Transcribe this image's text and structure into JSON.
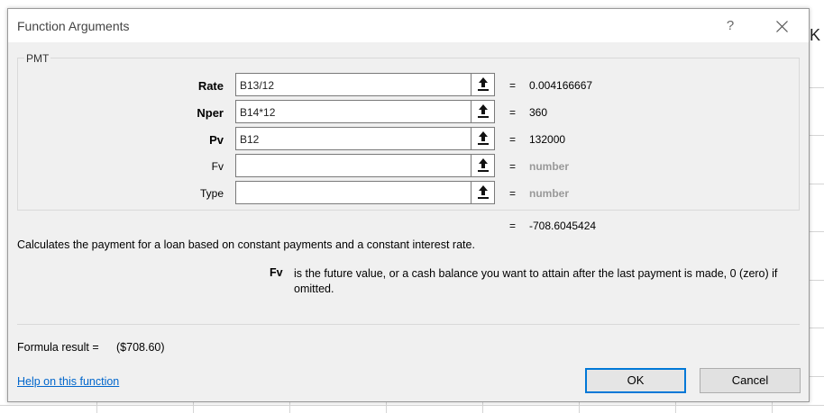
{
  "window": {
    "title": "Function Arguments",
    "help_glyph": "?",
    "background_column_header": "K"
  },
  "function": {
    "name": "PMT",
    "description": "Calculates the payment for a loan based on constant payments and a constant interest rate."
  },
  "arguments": [
    {
      "label": "Rate",
      "value": "B13/12",
      "evaluated": "0.004166667",
      "required": true
    },
    {
      "label": "Nper",
      "value": "B14*12",
      "evaluated": "360",
      "required": true
    },
    {
      "label": "Pv",
      "value": "B12",
      "evaluated": "132000",
      "required": true
    },
    {
      "label": "Fv",
      "value": "",
      "evaluated": "number",
      "required": false
    },
    {
      "label": "Type",
      "value": "",
      "evaluated": "number",
      "required": false
    }
  ],
  "equals_sign": "=",
  "result_value": "-708.6045424",
  "argument_help": {
    "name": "Fv",
    "text": "is the future value, or a cash balance you want to attain after the last payment is made, 0 (zero) if omitted."
  },
  "formula_result": {
    "label": "Formula result =",
    "value": "($708.60)"
  },
  "help_link": "Help on this function",
  "buttons": {
    "ok": "OK",
    "cancel": "Cancel"
  },
  "colors": {
    "dialog_bg": "#f0f0f0",
    "link": "#0066cc",
    "ok_border": "#0078d7",
    "hint_text": "#999999"
  },
  "icons": {
    "close": "close-icon",
    "collapse_dialog": "range-select-icon"
  }
}
